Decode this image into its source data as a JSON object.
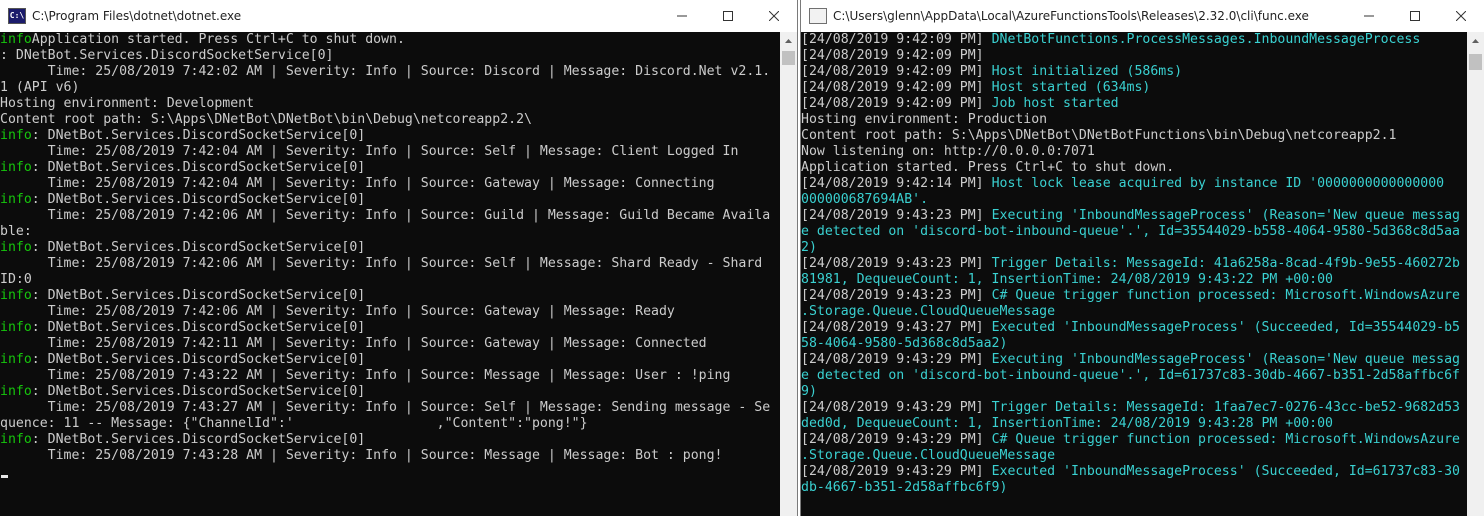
{
  "left_window": {
    "title": "C:\\Program Files\\dotnet\\dotnet.exe",
    "lines": [
      [
        {
          "t": "info",
          "c": "green"
        },
        {
          "t": "Application started. Press Ctrl+C to shut down.",
          "c": "gray"
        }
      ],
      [
        {
          "t": ": DNetBot.Services.DiscordSocketService[0]",
          "c": "gray"
        }
      ],
      [
        {
          "t": "      Time: 25/08/2019 7:42:02 AM | Severity: Info | Source: Discord | Message: Discord.Net v2.1.",
          "c": "gray"
        }
      ],
      [
        {
          "t": "1 (API v6)",
          "c": "gray"
        }
      ],
      [
        {
          "t": "Hosting environment: Development",
          "c": "gray"
        }
      ],
      [
        {
          "t": "Content root path: S:\\Apps\\DNetBot\\DNetBot\\bin\\Debug\\netcoreapp2.2\\",
          "c": "gray"
        }
      ],
      [
        {
          "t": "info",
          "c": "green"
        },
        {
          "t": ": DNetBot.Services.DiscordSocketService[0]",
          "c": "gray"
        }
      ],
      [
        {
          "t": "      Time: 25/08/2019 7:42:04 AM | Severity: Info | Source: Self | Message: Client Logged In",
          "c": "gray"
        }
      ],
      [
        {
          "t": "info",
          "c": "green"
        },
        {
          "t": ": DNetBot.Services.DiscordSocketService[0]",
          "c": "gray"
        }
      ],
      [
        {
          "t": "      Time: 25/08/2019 7:42:04 AM | Severity: Info | Source: Gateway | Message: Connecting",
          "c": "gray"
        }
      ],
      [
        {
          "t": "info",
          "c": "green"
        },
        {
          "t": ": DNetBot.Services.DiscordSocketService[0]",
          "c": "gray"
        }
      ],
      [
        {
          "t": "      Time: 25/08/2019 7:42:06 AM | Severity: Info | Source: Guild | Message: Guild Became Availa",
          "c": "gray"
        }
      ],
      [
        {
          "t": "ble:",
          "c": "gray"
        }
      ],
      [
        {
          "t": "info",
          "c": "green"
        },
        {
          "t": ": DNetBot.Services.DiscordSocketService[0]",
          "c": "gray"
        }
      ],
      [
        {
          "t": "      Time: 25/08/2019 7:42:06 AM | Severity: Info | Source: Self | Message: Shard Ready - Shard",
          "c": "gray"
        }
      ],
      [
        {
          "t": "ID:0",
          "c": "gray"
        }
      ],
      [
        {
          "t": "info",
          "c": "green"
        },
        {
          "t": ": DNetBot.Services.DiscordSocketService[0]",
          "c": "gray"
        }
      ],
      [
        {
          "t": "      Time: 25/08/2019 7:42:06 AM | Severity: Info | Source: Gateway | Message: Ready",
          "c": "gray"
        }
      ],
      [
        {
          "t": "info",
          "c": "green"
        },
        {
          "t": ": DNetBot.Services.DiscordSocketService[0]",
          "c": "gray"
        }
      ],
      [
        {
          "t": "      Time: 25/08/2019 7:42:11 AM | Severity: Info | Source: Gateway | Message: Connected",
          "c": "gray"
        }
      ],
      [
        {
          "t": "info",
          "c": "green"
        },
        {
          "t": ": DNetBot.Services.DiscordSocketService[0]",
          "c": "gray"
        }
      ],
      [
        {
          "t": "      Time: 25/08/2019 7:43:22 AM | Severity: Info | Source: Message | Message: User : !ping",
          "c": "gray"
        }
      ],
      [
        {
          "t": "info",
          "c": "green"
        },
        {
          "t": ": DNetBot.Services.DiscordSocketService[0]",
          "c": "gray"
        }
      ],
      [
        {
          "t": "      Time: 25/08/2019 7:43:27 AM | Severity: Info | Source: Self | Message: Sending message - Se",
          "c": "gray"
        }
      ],
      [
        {
          "t": "quence: 11 -- Message: {\"ChannelId\":'                  ,\"Content\":\"pong!\"}",
          "c": "gray"
        }
      ],
      [
        {
          "t": "info",
          "c": "green"
        },
        {
          "t": ": DNetBot.Services.DiscordSocketService[0]",
          "c": "gray"
        }
      ],
      [
        {
          "t": "      Time: 25/08/2019 7:43:28 AM | Severity: Info | Source: Message | Message: Bot : pong!",
          "c": "gray"
        }
      ]
    ]
  },
  "right_window": {
    "title": "C:\\Users\\glenn\\AppData\\Local\\AzureFunctionsTools\\Releases\\2.32.0\\cli\\func.exe",
    "lines": [
      [
        {
          "t": "[24/08/2019 9:42:09 PM] ",
          "c": "gray"
        },
        {
          "t": "DNetBotFunctions.ProcessMessages.InboundMessageProcess",
          "c": "cyan"
        }
      ],
      [
        {
          "t": "[24/08/2019 9:42:09 PM]",
          "c": "gray"
        }
      ],
      [
        {
          "t": "[24/08/2019 9:42:09 PM] ",
          "c": "gray"
        },
        {
          "t": "Host initialized (586ms)",
          "c": "cyan"
        }
      ],
      [
        {
          "t": "[24/08/2019 9:42:09 PM] ",
          "c": "gray"
        },
        {
          "t": "Host started (634ms)",
          "c": "cyan"
        }
      ],
      [
        {
          "t": "[24/08/2019 9:42:09 PM] ",
          "c": "gray"
        },
        {
          "t": "Job host started",
          "c": "cyan"
        }
      ],
      [
        {
          "t": "Hosting environment: Production",
          "c": "gray"
        }
      ],
      [
        {
          "t": "Content root path: S:\\Apps\\DNetBot\\DNetBotFunctions\\bin\\Debug\\netcoreapp2.1",
          "c": "gray"
        }
      ],
      [
        {
          "t": "Now listening on: http://0.0.0.0:7071",
          "c": "gray"
        }
      ],
      [
        {
          "t": "Application started. Press Ctrl+C to shut down.",
          "c": "gray"
        }
      ],
      [
        {
          "t": "[24/08/2019 9:42:14 PM] ",
          "c": "gray"
        },
        {
          "t": "Host lock lease acquired by instance ID '0000000000000000",
          "c": "cyan"
        }
      ],
      [
        {
          "t": "000000687694AB'.",
          "c": "cyan"
        }
      ],
      [
        {
          "t": "[24/08/2019 9:43:23 PM] ",
          "c": "gray"
        },
        {
          "t": "Executing 'InboundMessageProcess' (Reason='New queue messag",
          "c": "cyan"
        }
      ],
      [
        {
          "t": "e detected on 'discord-bot-inbound-queue'.', Id=35544029-b558-4064-9580-5d368c8d5aa",
          "c": "cyan"
        }
      ],
      [
        {
          "t": "2)",
          "c": "cyan"
        }
      ],
      [
        {
          "t": "[24/08/2019 9:43:23 PM] ",
          "c": "gray"
        },
        {
          "t": "Trigger Details: MessageId: 41a6258a-8cad-4f9b-9e55-460272b",
          "c": "cyan"
        }
      ],
      [
        {
          "t": "81981, DequeueCount: 1, InsertionTime: 24/08/2019 9:43:22 PM +00:00",
          "c": "cyan"
        }
      ],
      [
        {
          "t": "[24/08/2019 9:43:23 PM] ",
          "c": "gray"
        },
        {
          "t": "C# Queue trigger function processed: Microsoft.WindowsAzure",
          "c": "cyan"
        }
      ],
      [
        {
          "t": ".Storage.Queue.CloudQueueMessage",
          "c": "cyan"
        }
      ],
      [
        {
          "t": "[24/08/2019 9:43:27 PM] ",
          "c": "gray"
        },
        {
          "t": "Executed 'InboundMessageProcess' (Succeeded, Id=35544029-b5",
          "c": "cyan"
        }
      ],
      [
        {
          "t": "58-4064-9580-5d368c8d5aa2)",
          "c": "cyan"
        }
      ],
      [
        {
          "t": "[24/08/2019 9:43:29 PM] ",
          "c": "gray"
        },
        {
          "t": "Executing 'InboundMessageProcess' (Reason='New queue messag",
          "c": "cyan"
        }
      ],
      [
        {
          "t": "e detected on 'discord-bot-inbound-queue'.', Id=61737c83-30db-4667-b351-2d58affbc6f",
          "c": "cyan"
        }
      ],
      [
        {
          "t": "9)",
          "c": "cyan"
        }
      ],
      [
        {
          "t": "[24/08/2019 9:43:29 PM] ",
          "c": "gray"
        },
        {
          "t": "Trigger Details: MessageId: 1faa7ec7-0276-43cc-be52-9682d53",
          "c": "cyan"
        }
      ],
      [
        {
          "t": "ded0d, DequeueCount: 1, InsertionTime: 24/08/2019 9:43:28 PM +00:00",
          "c": "cyan"
        }
      ],
      [
        {
          "t": "[24/08/2019 9:43:29 PM] ",
          "c": "gray"
        },
        {
          "t": "C# Queue trigger function processed: Microsoft.WindowsAzure",
          "c": "cyan"
        }
      ],
      [
        {
          "t": ".Storage.Queue.CloudQueueMessage",
          "c": "cyan"
        }
      ],
      [
        {
          "t": "[24/08/2019 9:43:29 PM] ",
          "c": "gray"
        },
        {
          "t": "Executed 'InboundMessageProcess' (Succeeded, Id=61737c83-30",
          "c": "cyan"
        }
      ],
      [
        {
          "t": "db-4667-b351-2d58affbc6f9)",
          "c": "cyan"
        }
      ]
    ]
  },
  "icons": {
    "minimize": "minimize-icon",
    "maximize": "maximize-icon",
    "close": "close-icon",
    "scroll_up": "scroll-up-arrow-icon"
  },
  "colors": {
    "console_bg": "#0c0c0c",
    "text_gray": "#cccccc",
    "text_cyan": "#3ad1d1",
    "text_green": "#16c60c"
  }
}
